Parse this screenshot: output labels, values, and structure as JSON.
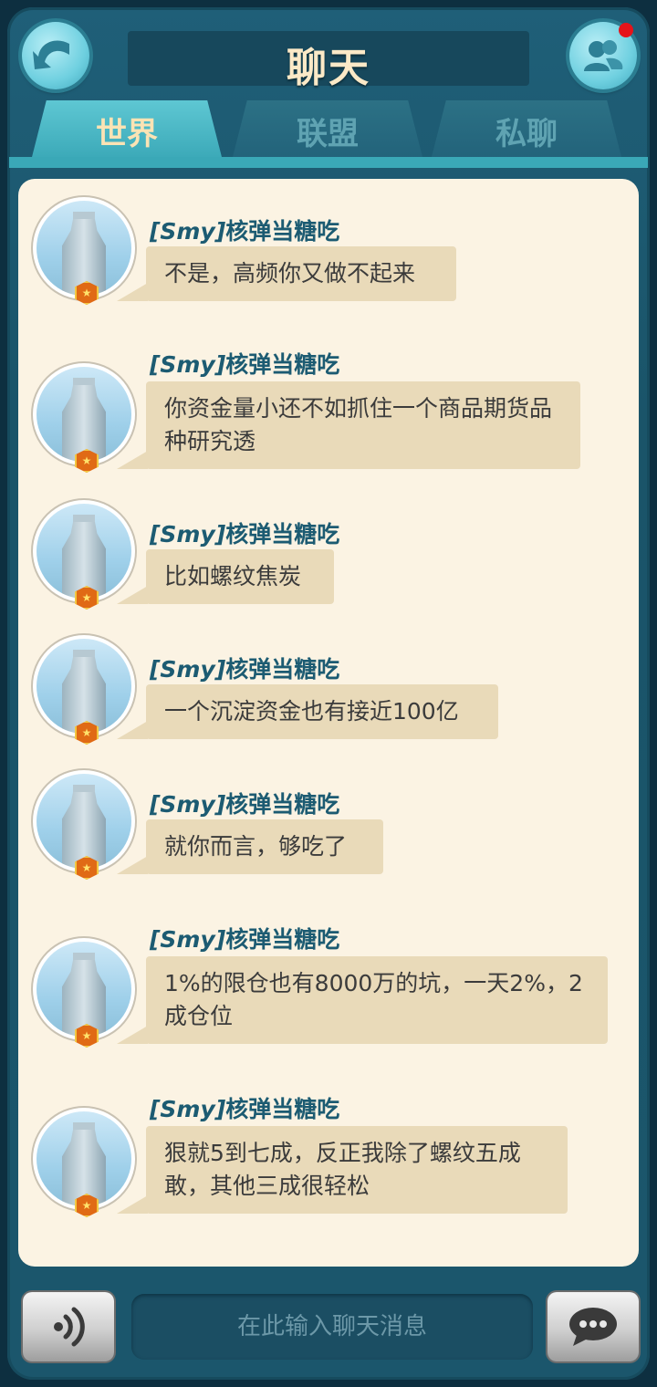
{
  "header": {
    "title": "聊天"
  },
  "tabs": [
    {
      "label": "世界",
      "active": true
    },
    {
      "label": "联盟",
      "active": false
    },
    {
      "label": "私聊",
      "active": false
    }
  ],
  "messages": [
    {
      "tag": "[Smy]",
      "sender": "核弹当糖吃",
      "text": "不是，高频你又做不起来"
    },
    {
      "tag": "[Smy]",
      "sender": "核弹当糖吃",
      "text": "你资金量小还不如抓住一个商品期货品种研究透"
    },
    {
      "tag": "[Smy]",
      "sender": "核弹当糖吃",
      "text": "比如螺纹焦炭"
    },
    {
      "tag": "[Smy]",
      "sender": "核弹当糖吃",
      "text": "一个沉淀资金也有接近100亿"
    },
    {
      "tag": "[Smy]",
      "sender": "核弹当糖吃",
      "text": "就你而言，够吃了"
    },
    {
      "tag": "[Smy]",
      "sender": "核弹当糖吃",
      "text": "1%的限仓也有8000万的坑，一天2%，2成仓位"
    },
    {
      "tag": "[Smy]",
      "sender": "核弹当糖吃",
      "text": "狠就5到七成，反正我除了螺纹五成敢，其他三成很轻松"
    }
  ],
  "input": {
    "placeholder": "在此输入聊天消息"
  },
  "icons": {
    "back": "back-arrow-icon",
    "friends": "friends-icon",
    "voice": "voice-icon",
    "send": "chat-bubble-icon"
  },
  "colors": {
    "accent": "#3aa8b7",
    "panel": "#fbf3e3",
    "bubble": "#e9dab9",
    "name": "#1c5b72",
    "title": "#fbe9c7",
    "notification": "#e5131a"
  }
}
